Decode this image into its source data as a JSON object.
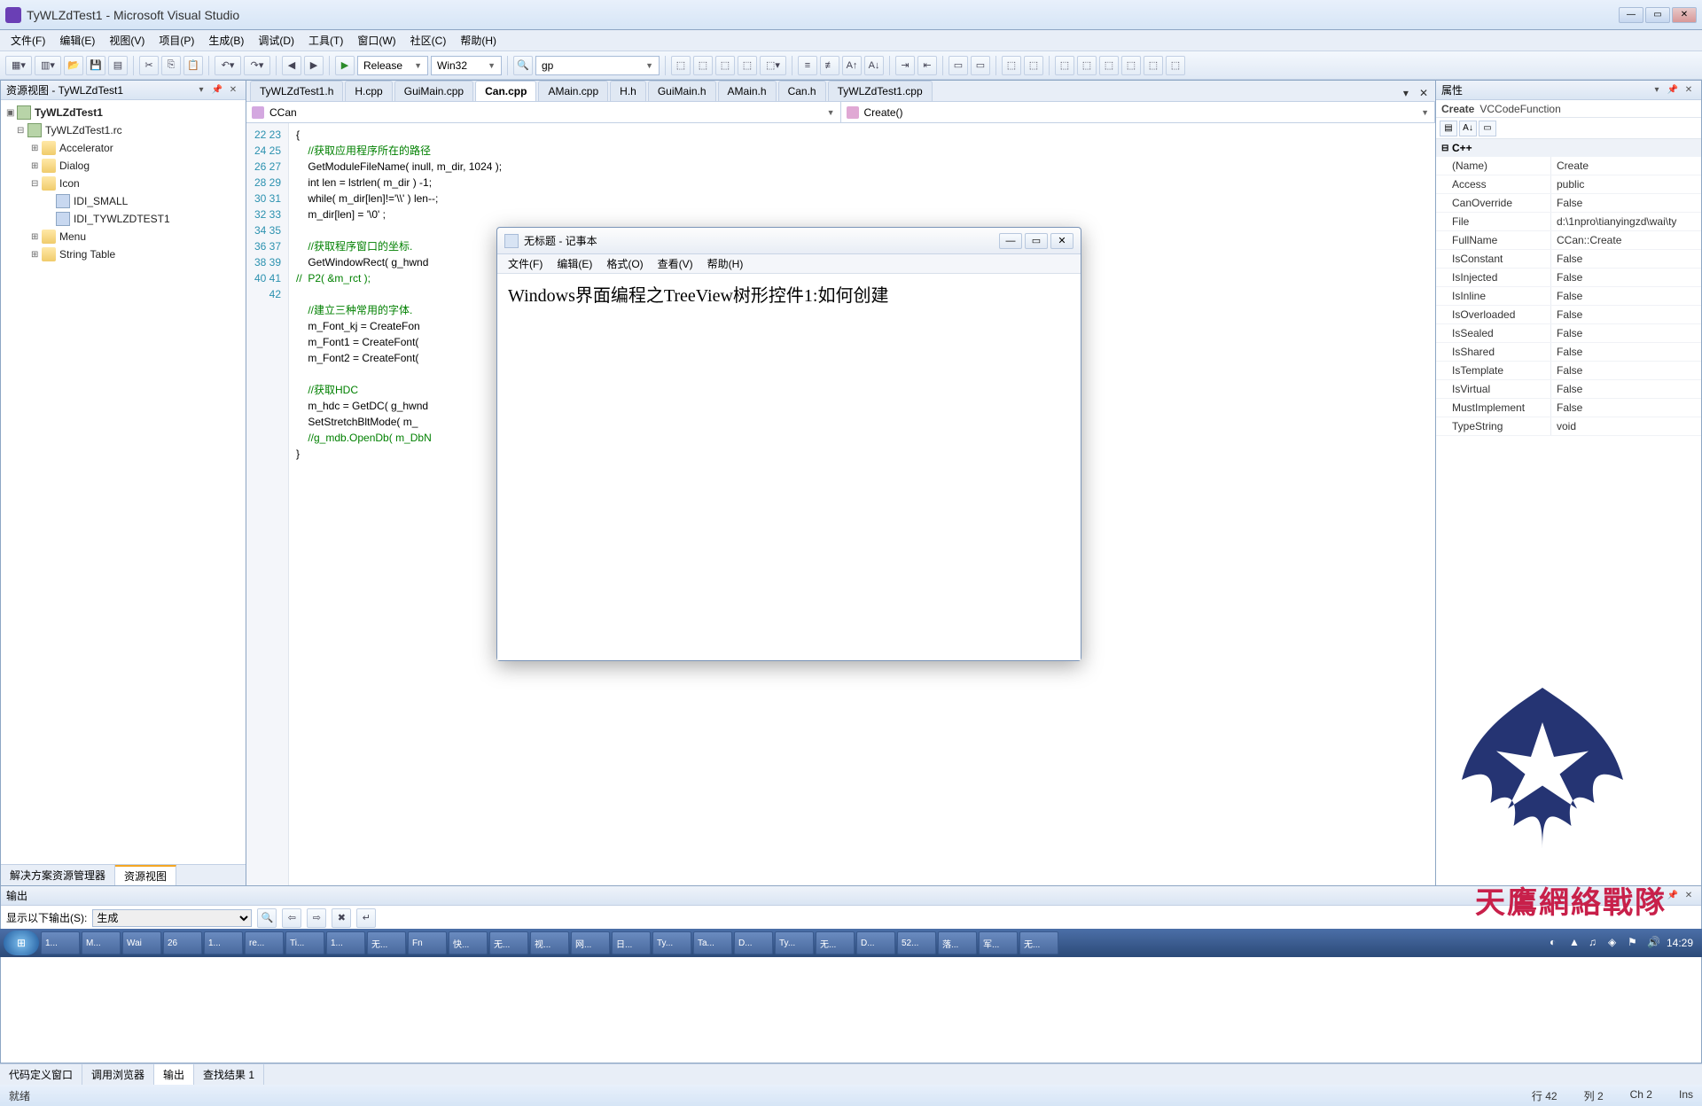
{
  "window": {
    "title": "TyWLZdTest1 - Microsoft Visual Studio"
  },
  "menus": [
    "文件(F)",
    "编辑(E)",
    "视图(V)",
    "项目(P)",
    "生成(B)",
    "调试(D)",
    "工具(T)",
    "窗口(W)",
    "社区(C)",
    "帮助(H)"
  ],
  "toolbar": {
    "config": "Release",
    "platform": "Win32",
    "find": "gp"
  },
  "resview": {
    "title": "资源视图 - TyWLZdTest1",
    "tabs": [
      "解决方案资源管理器",
      "资源视图"
    ],
    "root": "TyWLZdTest1",
    "rc": "TyWLZdTest1.rc",
    "folders": {
      "accel": "Accelerator",
      "dialog": "Dialog",
      "icon": "Icon",
      "idi_small": "IDI_SMALL",
      "idi_app": "IDI_TYWLZDTEST1",
      "menu": "Menu",
      "string": "String Table"
    }
  },
  "tabs": [
    "TyWLZdTest1.h",
    "H.cpp",
    "GuiMain.cpp",
    "Can.cpp",
    "AMain.cpp",
    "H.h",
    "GuiMain.h",
    "AMain.h",
    "Can.h",
    "TyWLZdTest1.cpp"
  ],
  "active_tab": "Can.cpp",
  "navbar": {
    "class": "CCan",
    "member": "Create()"
  },
  "code": {
    "start": 22,
    "lines": [
      "{",
      "    //获取应用程序所在的路径",
      "    GetModuleFileName( inull, m_dir, 1024 );",
      "    int len = lstrlen( m_dir ) -1;",
      "    while( m_dir[len]!='\\\\' ) len--;",
      "    m_dir[len] = '\\0' ;",
      "",
      "    //获取程序窗口的坐标.",
      "    GetWindowRect( g_hwnd",
      "//  P2( &m_rct );",
      "",
      "    //建立三种常用的字体.",
      "    m_Font_kj = CreateFon                                                                     iClip_Default_Precis, iDefault_Quality, iFixed_Pitch | iFf_Modern",
      "    m_Font1 = CreateFont(                                                                    Clip_Default_Precis, iDefault_Quality, iFixed_Pitch | iFf_Modern",
      "    m_Font2 = CreateFont(                                                                    Clip_Default_Precis, iDefault_Quality, iFixed_Pitch | iFf_Modern",
      "",
      "    //获取HDC",
      "    m_hdc = GetDC( g_hwnd",
      "    SetStretchBltMode( m_",
      "    //g_mdb.OpenDb( m_DbN",
      "}"
    ]
  },
  "props": {
    "title": "属性",
    "subject_name": "Create",
    "subject_type": "VCCodeFunction",
    "cat": "C++",
    "rows": [
      [
        "(Name)",
        "Create"
      ],
      [
        "Access",
        "public"
      ],
      [
        "CanOverride",
        "False"
      ],
      [
        "File",
        "d:\\1npro\\tianyingzd\\wai\\ty"
      ],
      [
        "FullName",
        "CCan::Create"
      ],
      [
        "IsConstant",
        "False"
      ],
      [
        "IsInjected",
        "False"
      ],
      [
        "IsInline",
        "False"
      ],
      [
        "IsOverloaded",
        "False"
      ],
      [
        "IsSealed",
        "False"
      ],
      [
        "IsShared",
        "False"
      ],
      [
        "IsTemplate",
        "False"
      ],
      [
        "IsVirtual",
        "False"
      ],
      [
        "MustImplement",
        "False"
      ],
      [
        "TypeString",
        "void"
      ]
    ]
  },
  "output": {
    "title": "输出",
    "label": "显示以下输出(S):",
    "source": "生成",
    "bottomtabs": [
      "代码定义窗口",
      "调用浏览器",
      "输出",
      "查找结果 1"
    ]
  },
  "status": {
    "ready": "就绪",
    "line": "行 42",
    "col": "列 2",
    "ch": "Ch 2",
    "ins": "Ins"
  },
  "notepad": {
    "title": "无标题 - 记事本",
    "menus": [
      "文件(F)",
      "编辑(E)",
      "格式(O)",
      "查看(V)",
      "帮助(H)"
    ],
    "body": "Windows界面编程之TreeView树形控件1:如何创建"
  },
  "watermark": "天鷹網絡戰隊",
  "taskbar": {
    "items": [
      "1...",
      "M...",
      "Wai",
      "26",
      "1...",
      "re...",
      "Ti...",
      "1...",
      "无...",
      "Fn",
      "快...",
      "无...",
      "视...",
      "网...",
      "日...",
      "Ty...",
      "Ta...",
      "D...",
      "Ty...",
      "无...",
      "D...",
      "52...",
      "落...",
      "军...",
      "无..."
    ],
    "time": "14:29"
  }
}
